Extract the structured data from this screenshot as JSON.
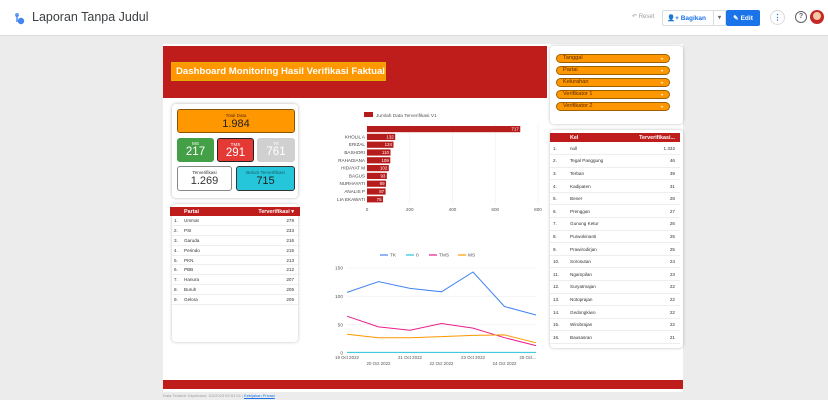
{
  "app": {
    "title": "Laporan Tanpa Judul",
    "reset_label": "Reset",
    "share_label": "Bagikan",
    "edit_label": "Edit",
    "footer_text": "Data Terakhir Diperbarui: 4/2/2025 09.51.04",
    "footer_link": "Kebijakan Privasi"
  },
  "dashboard": {
    "title": "Dashboard Monitoring Hasil Verifikasi Faktual"
  },
  "filters": [
    "Tanggal",
    "Partai",
    "Kelurahan",
    "Verifikator 1",
    "Verifikator 2"
  ],
  "scorecards": {
    "total": {
      "label": "Total Data",
      "value": "1.984"
    },
    "ms": {
      "label": "MS",
      "value": "217"
    },
    "tms": {
      "label": "TMS",
      "value": "291"
    },
    "tk": {
      "label": "TK",
      "value": "761"
    },
    "terverifikasi": {
      "label": "Terverifikasi",
      "value": "1.269"
    },
    "belum": {
      "label": "Belum Terverifikasi",
      "value": "715"
    }
  },
  "party_table": {
    "headers": [
      "Partai",
      "Terverifikasi ▾"
    ],
    "rows": [
      {
        "no": "1.",
        "name": "Ummat",
        "value": "278"
      },
      {
        "no": "2.",
        "name": "PSI",
        "value": "233"
      },
      {
        "no": "3.",
        "name": "Garuda",
        "value": "216"
      },
      {
        "no": "4.",
        "name": "Perindo",
        "value": "215"
      },
      {
        "no": "5.",
        "name": "PKN",
        "value": "213"
      },
      {
        "no": "6.",
        "name": "PBB",
        "value": "212"
      },
      {
        "no": "7.",
        "name": "Hanura",
        "value": "207"
      },
      {
        "no": "8.",
        "name": "Buruh",
        "value": "205"
      },
      {
        "no": "9.",
        "name": "Gelora",
        "value": "205"
      }
    ]
  },
  "kel_table": {
    "headers": [
      "Kel",
      "Terverifikasi..."
    ],
    "rows": [
      {
        "no": "1.",
        "name": "null",
        "value": "1.332"
      },
      {
        "no": "2.",
        "name": "Tegal Panggung",
        "value": "46"
      },
      {
        "no": "3.",
        "name": "Terban",
        "value": "39"
      },
      {
        "no": "4.",
        "name": "Kadipaten",
        "value": "31"
      },
      {
        "no": "5.",
        "name": "Bener",
        "value": "28"
      },
      {
        "no": "6.",
        "name": "Prenggan",
        "value": "27"
      },
      {
        "no": "7.",
        "name": "Gunung Ketur",
        "value": "26"
      },
      {
        "no": "8.",
        "name": "Purwokinanti",
        "value": "25"
      },
      {
        "no": "9.",
        "name": "Prawirodirjan",
        "value": "25"
      },
      {
        "no": "10.",
        "name": "Sorosutan",
        "value": "24"
      },
      {
        "no": "11.",
        "name": "Ngampilan",
        "value": "23"
      },
      {
        "no": "12.",
        "name": "Suryatmajan",
        "value": "22"
      },
      {
        "no": "13.",
        "name": "Notoprajan",
        "value": "22"
      },
      {
        "no": "14.",
        "name": "Gedongkiwo",
        "value": "22"
      },
      {
        "no": "15.",
        "name": "Wirobrajan",
        "value": "22"
      },
      {
        "no": "16.",
        "name": "Bausasran",
        "value": "21"
      }
    ]
  },
  "chart_data": [
    {
      "type": "bar",
      "orientation": "horizontal",
      "legend": "Jumlah Data Terverifikasi V1",
      "categories": [
        "",
        "KHOLIL A",
        "ERIZAL",
        "BASHORI",
        "RAHADIANA",
        "HIDAYAT M",
        "BAGUS",
        "NURHAYATI",
        "ANALIS P",
        "LIA EKAWATI"
      ],
      "values": [
        717,
        132,
        124,
        110,
        109,
        102,
        93,
        89,
        87,
        75
      ],
      "xticks": [
        0,
        200,
        400,
        600,
        800
      ],
      "xlim": [
        0,
        800
      ],
      "color": "#b71c1c"
    },
    {
      "type": "line",
      "legend_position": "top",
      "x": [
        "19 Oct 2022",
        "20 Oct 2022",
        "21 Oct 2022",
        "22 Oct 2022",
        "23 Oct 2022",
        "24 Oct 2022",
        "25 Oct..."
      ],
      "series": [
        {
          "name": "TK",
          "color": "#4285f4",
          "values": [
            107,
            126,
            114,
            108,
            143,
            82,
            67
          ]
        },
        {
          "name": "0",
          "color": "#26c6da",
          "values": [
            1,
            1,
            1,
            1,
            1,
            1,
            1
          ]
        },
        {
          "name": "TMS",
          "color": "#e91e8c",
          "values": [
            65,
            46,
            40,
            52,
            44,
            27,
            13
          ]
        },
        {
          "name": "MS",
          "color": "#ff9800",
          "values": [
            33,
            27,
            27,
            29,
            31,
            32,
            18
          ]
        }
      ],
      "yticks": [
        0,
        50,
        100,
        150
      ],
      "ylim": [
        0,
        150
      ]
    }
  ]
}
